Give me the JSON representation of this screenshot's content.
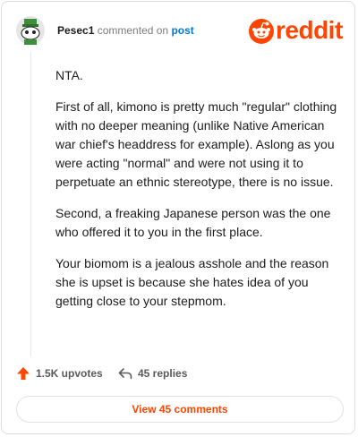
{
  "comment": {
    "username": "Pesec1",
    "action_text": "commented on",
    "target_link": "post",
    "paragraphs": [
      "NTA.",
      "First of all, kimono is pretty much \"regular\" clothing with no deeper meaning (unlike Native American war chief's headdress for example). Aslong as you were acting \"normal\" and were not using it to perpetuate an ethnic stereotype, there is no issue.",
      "Second, a freaking Japanese person was the one who offered it to you in the first place.",
      "Your biomom is a jealous asshole and the reason she is upset is because she hates idea of you getting close to your stepmom."
    ]
  },
  "brand": {
    "name": "reddit",
    "color": "#ff4500"
  },
  "actions": {
    "upvotes": "1.5K upvotes",
    "replies": "45 replies"
  },
  "view_button": {
    "label": "View 45 comments"
  }
}
